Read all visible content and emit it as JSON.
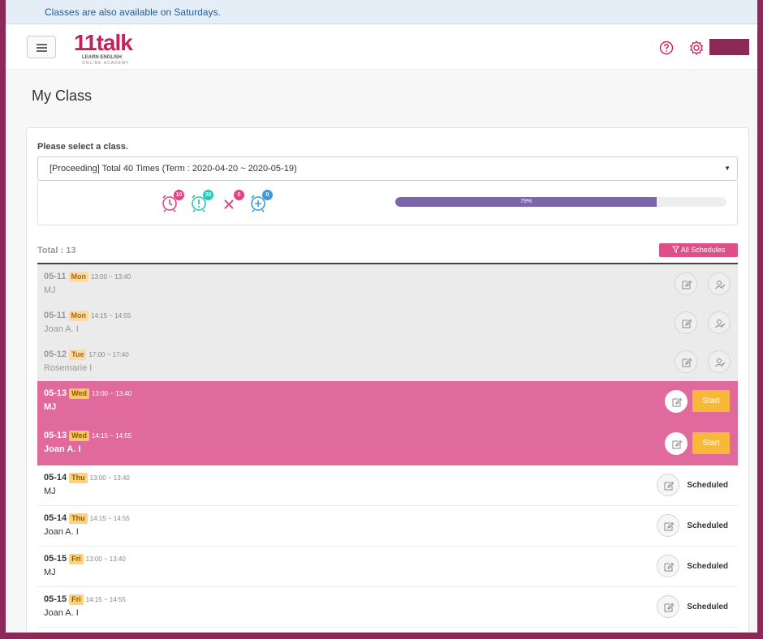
{
  "notice": "Classes are also available on Saturdays.",
  "logo": {
    "main": "11talk",
    "sub": "LEARN ENGLISH",
    "sub2": "ONLINE ACADEMY"
  },
  "page_title": "My Class",
  "select_label": "Please select a class.",
  "class_select": "[Proceeding] Total 40 Times (Term : 2020-04-20 ~ 2020-05-19)",
  "stats": [
    {
      "icon": "alarm-clock-icon",
      "value": "10",
      "color": "#e0457f"
    },
    {
      "icon": "alarm-warning-icon",
      "value": "30",
      "color": "#2ec4b6"
    },
    {
      "icon": "cross-icon",
      "value": "0",
      "color": "#e0457f"
    },
    {
      "icon": "alarm-plus-icon",
      "value": "0",
      "color": "#3a9be0"
    }
  ],
  "progress": {
    "label": "79%",
    "value": 0.79
  },
  "total": "Total : 13",
  "all_schedules": "All Schedules",
  "rows": [
    {
      "date": "05-11",
      "day": "Mon",
      "time": "13:00 ~ 13:40",
      "tutor": "MJ",
      "status": "past"
    },
    {
      "date": "05-11",
      "day": "Mon",
      "time": "14:15 ~ 14:55",
      "tutor": "Joan A. I",
      "status": "past"
    },
    {
      "date": "05-12",
      "day": "Tue",
      "time": "17:00 ~ 17:40",
      "tutor": "Rosemarie I",
      "status": "past"
    },
    {
      "date": "05-13",
      "day": "Wed",
      "time": "13:00 ~ 13:40",
      "tutor": "MJ",
      "status": "today",
      "action": "Start"
    },
    {
      "date": "05-13",
      "day": "Wed",
      "time": "14:15 ~ 14:55",
      "tutor": "Joan A. I",
      "status": "today",
      "action": "Start"
    },
    {
      "date": "05-14",
      "day": "Thu",
      "time": "13:00 ~ 13:40",
      "tutor": "MJ",
      "status": "future",
      "action": "Scheduled"
    },
    {
      "date": "05-14",
      "day": "Thu",
      "time": "14:15 ~ 14:55",
      "tutor": "Joan A. I",
      "status": "future",
      "action": "Scheduled"
    },
    {
      "date": "05-15",
      "day": "Fri",
      "time": "13:00 ~ 13:40",
      "tutor": "MJ",
      "status": "future",
      "action": "Scheduled"
    },
    {
      "date": "05-15",
      "day": "Fri",
      "time": "14:15 ~ 14:55",
      "tutor": "Joan A. I",
      "status": "future",
      "action": "Scheduled"
    }
  ],
  "colors": {
    "brand": "#c8205a",
    "frame": "#8c2957",
    "today_row": "#e0699e",
    "start": "#f8b93b",
    "progress": "#7d65ab"
  }
}
